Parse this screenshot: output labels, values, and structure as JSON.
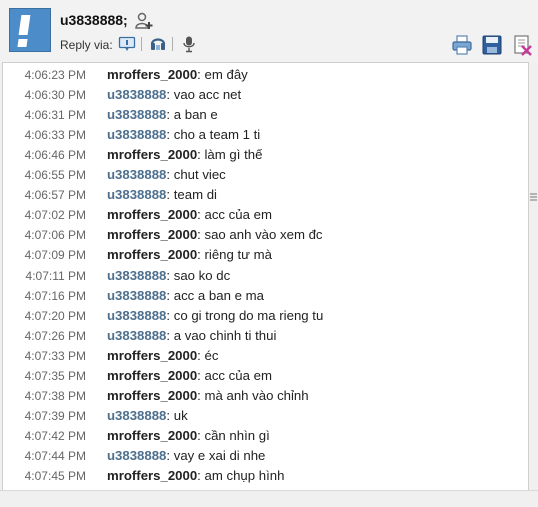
{
  "header": {
    "username": "u3838888;",
    "reply_via_label": "Reply via:",
    "icons": {
      "avatar": "alert-avatar",
      "add_contact": "add-contact-icon",
      "reply_im": "im-icon",
      "reply_phone": "phone-icon",
      "reply_voice": "microphone-icon",
      "print": "print-icon",
      "save": "save-icon",
      "delete": "delete-icon"
    }
  },
  "colors": {
    "other_name": "#222222",
    "self_name": "#4c6f8e",
    "timestamp": "#666666",
    "avatar_blue": "#4b8cc9"
  },
  "messages": [
    {
      "time": "4:06:23 PM",
      "sender": "mroffers_2000",
      "self": false,
      "text": "em đây"
    },
    {
      "time": "4:06:30 PM",
      "sender": "u3838888",
      "self": true,
      "text": "vao acc net"
    },
    {
      "time": "4:06:31 PM",
      "sender": "u3838888",
      "self": true,
      "text": "a ban e"
    },
    {
      "time": "4:06:33 PM",
      "sender": "u3838888",
      "self": true,
      "text": "cho a team 1 ti"
    },
    {
      "time": "4:06:46 PM",
      "sender": "mroffers_2000",
      "self": false,
      "text": "làm gì thế"
    },
    {
      "time": "4:06:55 PM",
      "sender": "u3838888",
      "self": true,
      "text": "chut viec"
    },
    {
      "time": "4:06:57 PM",
      "sender": "u3838888",
      "self": true,
      "text": "team di"
    },
    {
      "time": "4:07:02 PM",
      "sender": "mroffers_2000",
      "self": false,
      "text": "acc của em"
    },
    {
      "time": "4:07:06 PM",
      "sender": "mroffers_2000",
      "self": false,
      "text": "sao anh vào xem đc"
    },
    {
      "time": "4:07:09 PM",
      "sender": "mroffers_2000",
      "self": false,
      "text": "riêng tư mà"
    },
    {
      "time": "4:07:11 PM",
      "sender": "u3838888",
      "self": true,
      "text": "sao ko dc"
    },
    {
      "time": "4:07:16 PM",
      "sender": "u3838888",
      "self": true,
      "text": "acc a ban e ma"
    },
    {
      "time": "4:07:20 PM",
      "sender": "u3838888",
      "self": true,
      "text": "co gi trong do ma rieng tu"
    },
    {
      "time": "4:07:26 PM",
      "sender": "u3838888",
      "self": true,
      "text": "a vao chinh ti thui"
    },
    {
      "time": "4:07:33 PM",
      "sender": "mroffers_2000",
      "self": false,
      "text": "éc"
    },
    {
      "time": "4:07:35 PM",
      "sender": "mroffers_2000",
      "self": false,
      "text": "acc của em"
    },
    {
      "time": "4:07:38 PM",
      "sender": "mroffers_2000",
      "self": false,
      "text": "mà anh vào chỉnh"
    },
    {
      "time": "4:07:39 PM",
      "sender": "u3838888",
      "self": true,
      "text": "uk"
    },
    {
      "time": "4:07:42 PM",
      "sender": "mroffers_2000",
      "self": false,
      "text": "cần nhìn gì"
    },
    {
      "time": "4:07:44 PM",
      "sender": "u3838888",
      "self": true,
      "text": "vay e xai di nhe"
    },
    {
      "time": "4:07:45 PM",
      "sender": "mroffers_2000",
      "self": false,
      "text": "am chụp hình"
    }
  ]
}
